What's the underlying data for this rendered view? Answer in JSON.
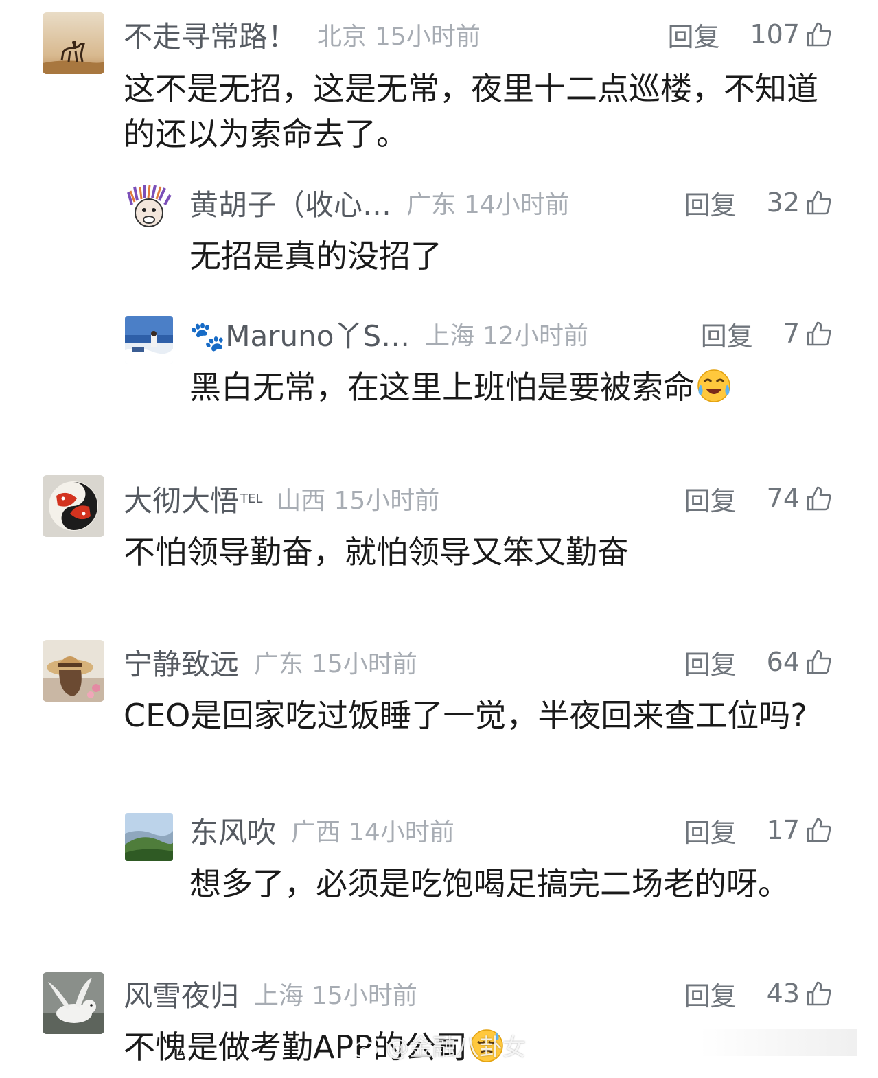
{
  "comments": [
    {
      "username": "不走寻常路！",
      "region": "北京",
      "time": "15小时前",
      "reply_label": "回复",
      "likes": "107",
      "text": "这不是无招，这是无常，夜里十二点巡楼，不知道的还以为索命去了。",
      "avatar": "camel-rider-avatar"
    },
    {
      "username": "黄胡子（收心…",
      "region": "广东",
      "time": "14小时前",
      "reply_label": "回复",
      "likes": "32",
      "text": "无招是真的没招了",
      "avatar": "cartoon-face-avatar"
    },
    {
      "username": "🐾Maruno丫S…",
      "region": "上海",
      "time": "12小时前",
      "reply_label": "回复",
      "likes": "7",
      "text": "黑白无常，在这里上班怕是要被索命",
      "emoji": "cry-laugh-emoji",
      "avatar": "seaside-photo-avatar"
    },
    {
      "username": "大彻大悟",
      "badge": "TEL",
      "region": "山西",
      "time": "15小时前",
      "reply_label": "回复",
      "likes": "74",
      "text": "不怕领导勤奋，就怕领导又笨又勤奋",
      "avatar": "koi-fish-avatar"
    },
    {
      "username": "宁静致远",
      "region": "广东",
      "time": "15小时前",
      "reply_label": "回复",
      "likes": "64",
      "text": "CEO是回家吃过饭睡了一觉，半夜回来查工位吗?",
      "avatar": "straw-hat-avatar"
    },
    {
      "username": "东风吹",
      "region": "广西",
      "time": "14小时前",
      "reply_label": "回复",
      "likes": "17",
      "text": "想多了，必须是吃饱喝足搞完二场老的呀。",
      "avatar": "mountain-avatar"
    },
    {
      "username": "风雪夜归",
      "region": "上海",
      "time": "15小时前",
      "reply_label": "回复",
      "likes": "43",
      "text": "不愧是做考勤APP的公司",
      "emoji": "sweat-emoji",
      "avatar": "white-creature-avatar"
    }
  ],
  "watermark": "@金融八卦女",
  "colors": {
    "username": "#555a61",
    "meta": "#a7acb3",
    "action": "#6f757c",
    "body": "#1a1a1a"
  }
}
